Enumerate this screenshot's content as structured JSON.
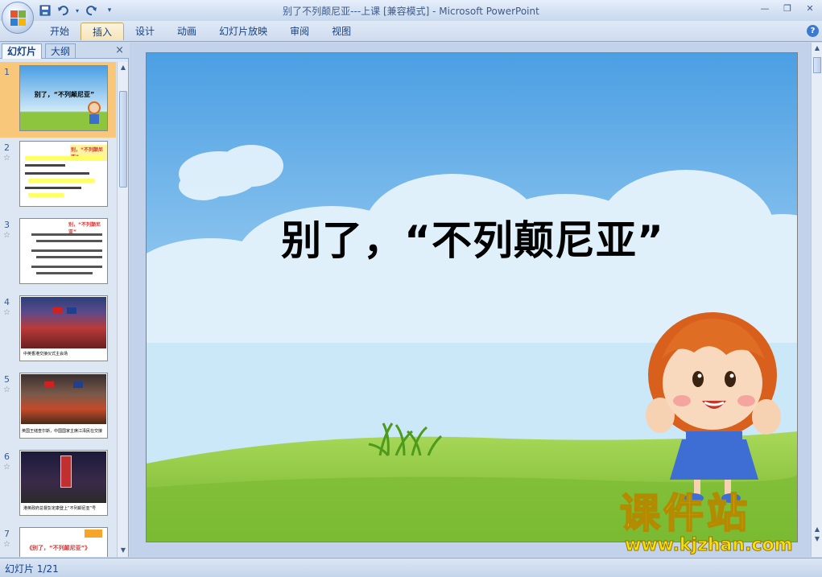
{
  "window": {
    "title": "别了不列颠尼亚---上课 [兼容模式] - Microsoft PowerPoint"
  },
  "quick_access": {
    "icons": [
      "save-icon",
      "undo-icon",
      "redo-icon",
      "customize-icon"
    ]
  },
  "ribbon": {
    "tabs": [
      {
        "label": "开始",
        "active": false
      },
      {
        "label": "插入",
        "active": true
      },
      {
        "label": "设计",
        "active": false
      },
      {
        "label": "动画",
        "active": false
      },
      {
        "label": "幻灯片放映",
        "active": false
      },
      {
        "label": "审阅",
        "active": false
      },
      {
        "label": "视图",
        "active": false
      }
    ],
    "help": "?"
  },
  "panel": {
    "tabs": [
      {
        "label": "幻灯片",
        "active": true
      },
      {
        "label": "大纲",
        "active": false
      }
    ],
    "close": "×",
    "slides": [
      {
        "number": "1",
        "selected": true,
        "caption": "别了，“不列颠尼亚”"
      },
      {
        "number": "2",
        "selected": false,
        "caption": "别，“不列颠尼亚”"
      },
      {
        "number": "3",
        "selected": false,
        "caption": "别，“不列颠尼亚”"
      },
      {
        "number": "4",
        "selected": false,
        "caption": "中英香港交接仪式主会场"
      },
      {
        "number": "5",
        "selected": false,
        "caption": "英国王储查尔斯，中国国家主席江泽民在交接"
      },
      {
        "number": "6",
        "selected": false,
        "caption": "港英政府总督彭定康登上“不列颠尼亚”号"
      },
      {
        "number": "7",
        "selected": false,
        "caption": "《别了，“不列颠尼亚”》"
      }
    ]
  },
  "slide": {
    "title": "别了，“不列颠尼亚”"
  },
  "watermark": {
    "brand": "课件站",
    "url": "www.kjzhan.com"
  },
  "status": {
    "text": "幻灯片 1/21"
  },
  "colors": {
    "sky_top": "#4b9fe3",
    "sky_bottom": "#bfe3f7",
    "grass": "#8dc53e",
    "selection": "#f8c77a"
  }
}
